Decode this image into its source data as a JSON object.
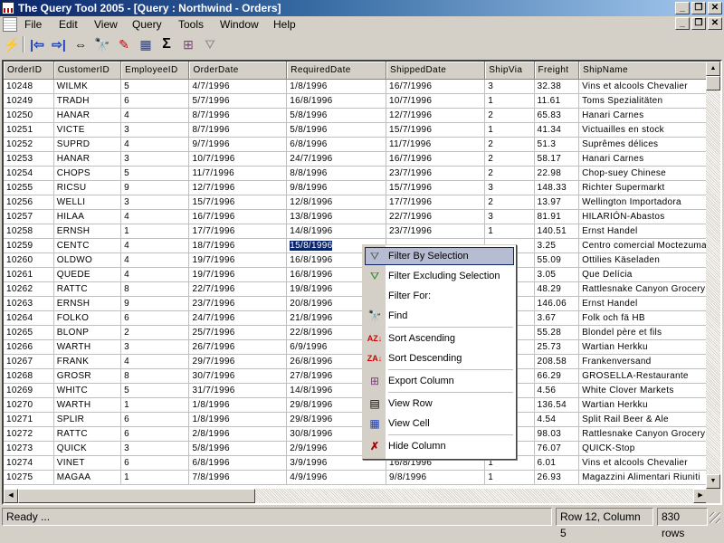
{
  "window": {
    "title": "The Query Tool 2005 - [Query : Northwind - Orders]",
    "caption_buttons": {
      "minimize": "_",
      "restore": "❐",
      "close": "✕"
    }
  },
  "menu": [
    {
      "label": "File",
      "mnemonic": "F"
    },
    {
      "label": "Edit",
      "mnemonic": "E"
    },
    {
      "label": "View",
      "mnemonic": "V"
    },
    {
      "label": "Query",
      "mnemonic": "Q"
    },
    {
      "label": "Tools",
      "mnemonic": "T"
    },
    {
      "label": "Window",
      "mnemonic": "W"
    },
    {
      "label": "Help",
      "mnemonic": "H"
    }
  ],
  "toolbar": {
    "icons": [
      "execute-icon",
      "first-icon",
      "last-icon",
      "swap-icon",
      "find-icon",
      "edit-icon",
      "table-icon",
      "sum-icon",
      "export-icon",
      "filter-icon"
    ]
  },
  "grid": {
    "columns": [
      "OrderID",
      "CustomerID",
      "EmployeeID",
      "OrderDate",
      "RequiredDate",
      "ShippedDate",
      "ShipVia",
      "Freight",
      "ShipName"
    ],
    "rows": [
      [
        "10248",
        "WILMK",
        "5",
        "4/7/1996",
        "1/8/1996",
        "16/7/1996",
        "3",
        "32.38",
        "Vins et alcools Chevalier"
      ],
      [
        "10249",
        "TRADH",
        "6",
        "5/7/1996",
        "16/8/1996",
        "10/7/1996",
        "1",
        "11.61",
        "Toms Spezialitäten"
      ],
      [
        "10250",
        "HANAR",
        "4",
        "8/7/1996",
        "5/8/1996",
        "12/7/1996",
        "2",
        "65.83",
        "Hanari Carnes"
      ],
      [
        "10251",
        "VICTE",
        "3",
        "8/7/1996",
        "5/8/1996",
        "15/7/1996",
        "1",
        "41.34",
        "Victuailles en stock"
      ],
      [
        "10252",
        "SUPRD",
        "4",
        "9/7/1996",
        "6/8/1996",
        "11/7/1996",
        "2",
        "51.3",
        "Suprêmes délices"
      ],
      [
        "10253",
        "HANAR",
        "3",
        "10/7/1996",
        "24/7/1996",
        "16/7/1996",
        "2",
        "58.17",
        "Hanari Carnes"
      ],
      [
        "10254",
        "CHOPS",
        "5",
        "11/7/1996",
        "8/8/1996",
        "23/7/1996",
        "2",
        "22.98",
        "Chop-suey Chinese"
      ],
      [
        "10255",
        "RICSU",
        "9",
        "12/7/1996",
        "9/8/1996",
        "15/7/1996",
        "3",
        "148.33",
        "Richter Supermarkt"
      ],
      [
        "10256",
        "WELLI",
        "3",
        "15/7/1996",
        "12/8/1996",
        "17/7/1996",
        "2",
        "13.97",
        "Wellington Importadora"
      ],
      [
        "10257",
        "HILAA",
        "4",
        "16/7/1996",
        "13/8/1996",
        "22/7/1996",
        "3",
        "81.91",
        "HILARIÓN-Abastos"
      ],
      [
        "10258",
        "ERNSH",
        "1",
        "17/7/1996",
        "14/8/1996",
        "23/7/1996",
        "1",
        "140.51",
        "Ernst Handel"
      ],
      [
        "10259",
        "CENTC",
        "4",
        "18/7/1996",
        "15/8/1996",
        "",
        "",
        "3.25",
        "Centro comercial Moctezuma"
      ],
      [
        "10260",
        "OLDWO",
        "4",
        "19/7/1996",
        "16/8/1996",
        "",
        "",
        "55.09",
        "Ottilies Käseladen"
      ],
      [
        "10261",
        "QUEDE",
        "4",
        "19/7/1996",
        "16/8/1996",
        "",
        "",
        "3.05",
        "Que Delícia"
      ],
      [
        "10262",
        "RATTC",
        "8",
        "22/7/1996",
        "19/8/1996",
        "",
        "",
        "48.29",
        "Rattlesnake Canyon Grocery"
      ],
      [
        "10263",
        "ERNSH",
        "9",
        "23/7/1996",
        "20/8/1996",
        "",
        "",
        "146.06",
        "Ernst Handel"
      ],
      [
        "10264",
        "FOLKO",
        "6",
        "24/7/1996",
        "21/8/1996",
        "",
        "",
        "3.67",
        "Folk och fä HB"
      ],
      [
        "10265",
        "BLONP",
        "2",
        "25/7/1996",
        "22/8/1996",
        "",
        "",
        "55.28",
        "Blondel père et fils"
      ],
      [
        "10266",
        "WARTH",
        "3",
        "26/7/1996",
        "6/9/1996",
        "",
        "",
        "25.73",
        "Wartian Herkku"
      ],
      [
        "10267",
        "FRANK",
        "4",
        "29/7/1996",
        "26/8/1996",
        "",
        "",
        "208.58",
        "Frankenversand"
      ],
      [
        "10268",
        "GROSR",
        "8",
        "30/7/1996",
        "27/8/1996",
        "",
        "",
        "66.29",
        "GROSELLA-Restaurante"
      ],
      [
        "10269",
        "WHITC",
        "5",
        "31/7/1996",
        "14/8/1996",
        "",
        "",
        "4.56",
        "White Clover Markets"
      ],
      [
        "10270",
        "WARTH",
        "1",
        "1/8/1996",
        "29/8/1996",
        "",
        "",
        "136.54",
        "Wartian Herkku"
      ],
      [
        "10271",
        "SPLIR",
        "6",
        "1/8/1996",
        "29/8/1996",
        "",
        "",
        "4.54",
        "Split Rail Beer & Ale"
      ],
      [
        "10272",
        "RATTC",
        "6",
        "2/8/1996",
        "30/8/1996",
        "",
        "",
        "98.03",
        "Rattlesnake Canyon Grocery"
      ],
      [
        "10273",
        "QUICK",
        "3",
        "5/8/1996",
        "2/9/1996",
        "",
        "",
        "76.07",
        "QUICK-Stop"
      ],
      [
        "10274",
        "VINET",
        "6",
        "6/8/1996",
        "3/9/1996",
        "16/8/1996",
        "1",
        "6.01",
        "Vins et alcools Chevalier"
      ],
      [
        "10275",
        "MAGAA",
        "1",
        "7/8/1996",
        "4/9/1996",
        "9/8/1996",
        "1",
        "26.93",
        "Magazzini Alimentari Riuniti"
      ]
    ],
    "selected_cell": {
      "row": 11,
      "column": 4
    }
  },
  "context_menu": {
    "items": [
      {
        "label": "Filter By Selection",
        "icon": "filter-selection-icon",
        "highlighted": true
      },
      {
        "label": "Filter Excluding Selection",
        "icon": "filter-excluding-icon"
      },
      {
        "label": "Filter For:",
        "icon": ""
      },
      {
        "label": "Find",
        "icon": "binoculars-icon"
      },
      {
        "label": "Sort Ascending",
        "icon": "sort-ascending-icon"
      },
      {
        "label": "Sort Descending",
        "icon": "sort-descending-icon"
      },
      {
        "label": "Export Column",
        "icon": "export-column-icon"
      },
      {
        "label": "View Row",
        "icon": "view-row-icon"
      },
      {
        "label": "View Cell",
        "icon": "view-cell-icon"
      },
      {
        "label": "Hide Column",
        "icon": "hide-column-icon"
      }
    ]
  },
  "status": {
    "message": "Ready ...",
    "position": "Row 12, Column 5",
    "row_count": "830 rows"
  }
}
